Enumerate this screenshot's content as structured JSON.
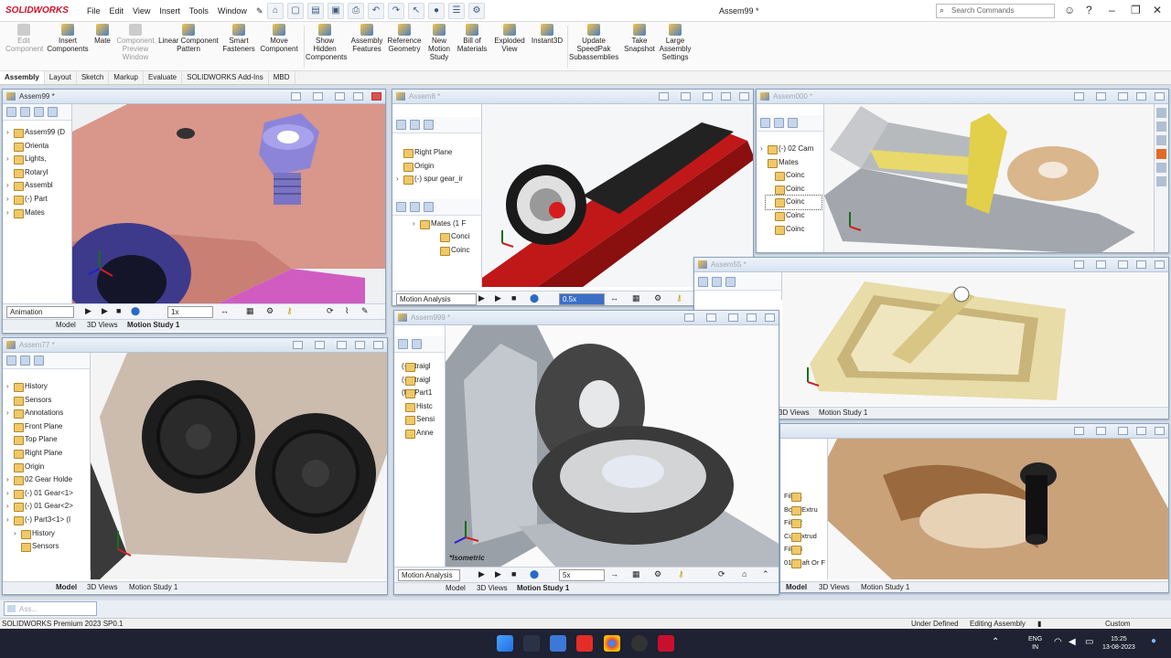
{
  "app": {
    "brand": "SOLIDWORKS",
    "window_title": "Assem99 *",
    "search_placeholder": "Search Commands"
  },
  "menu": [
    "File",
    "Edit",
    "View",
    "Insert",
    "Tools",
    "Window"
  ],
  "ribbon": [
    {
      "label": "Edit\nComponent",
      "disabled": true
    },
    {
      "label": "Insert\nComponents",
      "disabled": false
    },
    {
      "label": "Mate",
      "disabled": false
    },
    {
      "label": "Component\nPreview\nWindow",
      "disabled": true
    },
    {
      "label": "Linear Component\nPattern",
      "disabled": false
    },
    {
      "label": "Smart\nFasteners",
      "disabled": false
    },
    {
      "label": "Move\nComponent",
      "disabled": false
    },
    {
      "label": "Show\nHidden\nComponents",
      "disabled": false
    },
    {
      "label": "Assembly\nFeatures",
      "disabled": false
    },
    {
      "label": "Reference\nGeometry",
      "disabled": false
    },
    {
      "label": "New\nMotion\nStudy",
      "disabled": false
    },
    {
      "label": "Bill of\nMaterials",
      "disabled": false
    },
    {
      "label": "Exploded\nView",
      "disabled": false
    },
    {
      "label": "Instant3D",
      "disabled": false
    },
    {
      "label": "Update\nSpeedPak\nSubassemblies",
      "disabled": false
    },
    {
      "label": "Take\nSnapshot",
      "disabled": false
    },
    {
      "label": "Large\nAssembly\nSettings",
      "disabled": false
    }
  ],
  "cm_tabs": [
    "Assembly",
    "Layout",
    "Sketch",
    "Markup",
    "Evaluate",
    "SOLIDWORKS Add-Ins",
    "MBD"
  ],
  "windows": {
    "w1": {
      "title": "Assem99 *",
      "tree": [
        "Assem99 (D",
        "Orienta",
        "Lights,",
        "Rotaryl",
        "Assembl",
        "(-) Part",
        "Mates"
      ],
      "mode": "Animation",
      "speed": "1x",
      "tabs": [
        "Model",
        "3D Views",
        "Motion Study 1"
      ]
    },
    "w2": {
      "title": "Assem8 *",
      "tree": [
        "Right Plane",
        "Origin",
        "(-) spur gear_ir"
      ],
      "tree2": [
        "Mates (1 F",
        "Conci",
        "Coinc"
      ],
      "mode": "Motion Analysis",
      "speed": "0.5x",
      "tabs": []
    },
    "w3": {
      "title": "Assem000 *",
      "tree": [
        "(-) 02 Cam",
        "Mates",
        "Coinc",
        "Coinc",
        "Coinc",
        "Coinc",
        "Coinc"
      ]
    },
    "w4": {
      "title": "Assem77 *",
      "tree": [
        "History",
        "Sensors",
        "Annotations",
        "Front Plane",
        "Top Plane",
        "Right Plane",
        "Origin",
        "02 Gear Holde",
        "(-) 01 Gear<1>",
        "(-) 01 Gear<2>",
        "(-) Part3<1> (I",
        "History",
        "Sensors"
      ],
      "tabs": [
        "Model",
        "3D Views",
        "Motion Study 1"
      ]
    },
    "w5": {
      "title": "Assem999 *",
      "tree": [
        "(-) straigl",
        "(-) straigl",
        "(f) [ Part1",
        "Histc",
        "Sensi",
        "Anne"
      ],
      "view_label": "*Isometric",
      "mode": "Motion Analysis",
      "speed": "5x",
      "tabs": [
        "Model",
        "3D Views",
        "Motion Study 1"
      ]
    },
    "w6": {
      "title": "Assem55 *",
      "tabs": [
        "3D Views",
        "Motion Study 1"
      ]
    },
    "w7": {
      "title": "",
      "tree": [
        "Fillet1",
        "Boss-Extru",
        "Fillet2",
        "Cut-Extrud",
        "Fillet3",
        "01 Shaft Or F"
      ],
      "tabs": [
        "Model",
        "3D Views",
        "Motion Study 1"
      ]
    }
  },
  "minitab": "Ass...",
  "status": {
    "product": "SOLIDWORKS Premium 2023 SP0.1",
    "state": "Under Defined",
    "mode": "Editing Assembly",
    "units": "Custom"
  },
  "tray": {
    "lang": "ENG",
    "region": "IN",
    "time": "15:25",
    "date": "13-08-2023"
  }
}
